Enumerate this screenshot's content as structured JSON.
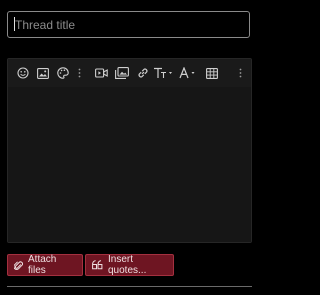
{
  "thread_title": {
    "value": "",
    "placeholder": "Thread title"
  },
  "toolbar": {
    "icons": [
      "smiley-icon",
      "image-icon",
      "palette-icon",
      "more-vertical-icon",
      "video-icon",
      "media-gallery-icon",
      "link-icon",
      "text-size-icon",
      "font-icon",
      "table-icon",
      "more-vertical-icon"
    ]
  },
  "actions": {
    "attach_label": "Attach files",
    "quotes_label": "Insert quotes..."
  },
  "colors": {
    "background": "#000000",
    "editor_bg": "#1a1a1a",
    "button_bg": "#6e1522",
    "button_border": "#a4303f"
  }
}
